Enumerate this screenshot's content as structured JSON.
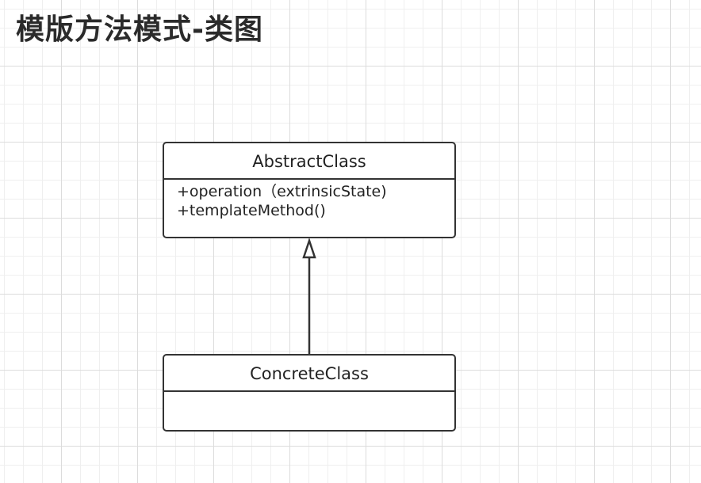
{
  "title": "模版方法模式-类图",
  "diagram": {
    "type": "uml-class-diagram",
    "classes": [
      {
        "name": "AbstractClass",
        "methods": [
          "+operation（extrinsicState)",
          "+templateMethod()"
        ]
      },
      {
        "name": "ConcreteClass",
        "methods": []
      }
    ],
    "relationships": [
      {
        "type": "generalization",
        "from": "ConcreteClass",
        "to": "AbstractClass"
      }
    ]
  },
  "colors": {
    "background": "#ffffff",
    "grid": "#dcdcdc",
    "stroke": "#333333"
  }
}
